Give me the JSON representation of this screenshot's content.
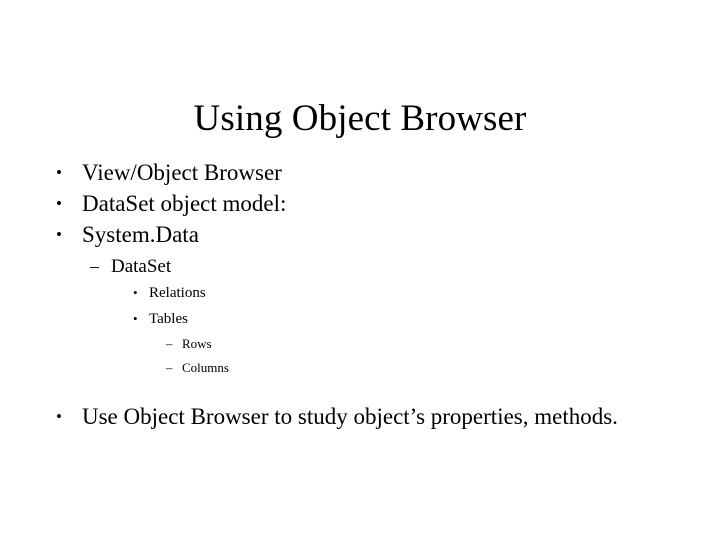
{
  "slide": {
    "title": "Using Object Browser",
    "background_color": "#ffffff",
    "text_color": "#000000",
    "bullet_glyphs": {
      "level1": "•",
      "level2": "–",
      "level3": "•",
      "level4": "–"
    },
    "outline": [
      {
        "level": 1,
        "marker": "•",
        "text": "View/Object Browser"
      },
      {
        "level": 1,
        "marker": "•",
        "text": "DataSet object model:"
      },
      {
        "level": 1,
        "marker": "•",
        "text": "System.Data"
      },
      {
        "level": 2,
        "marker": "–",
        "text": "DataSet"
      },
      {
        "level": 3,
        "marker": "•",
        "text": "Relations"
      },
      {
        "level": 3,
        "marker": "•",
        "text": "Tables"
      },
      {
        "level": 4,
        "marker": "–",
        "text": "Rows"
      },
      {
        "level": 4,
        "marker": "–",
        "text": "Columns"
      },
      {
        "level": 1,
        "marker": "•",
        "text": "Use Object Browser to study object’s properties, methods."
      }
    ]
  }
}
